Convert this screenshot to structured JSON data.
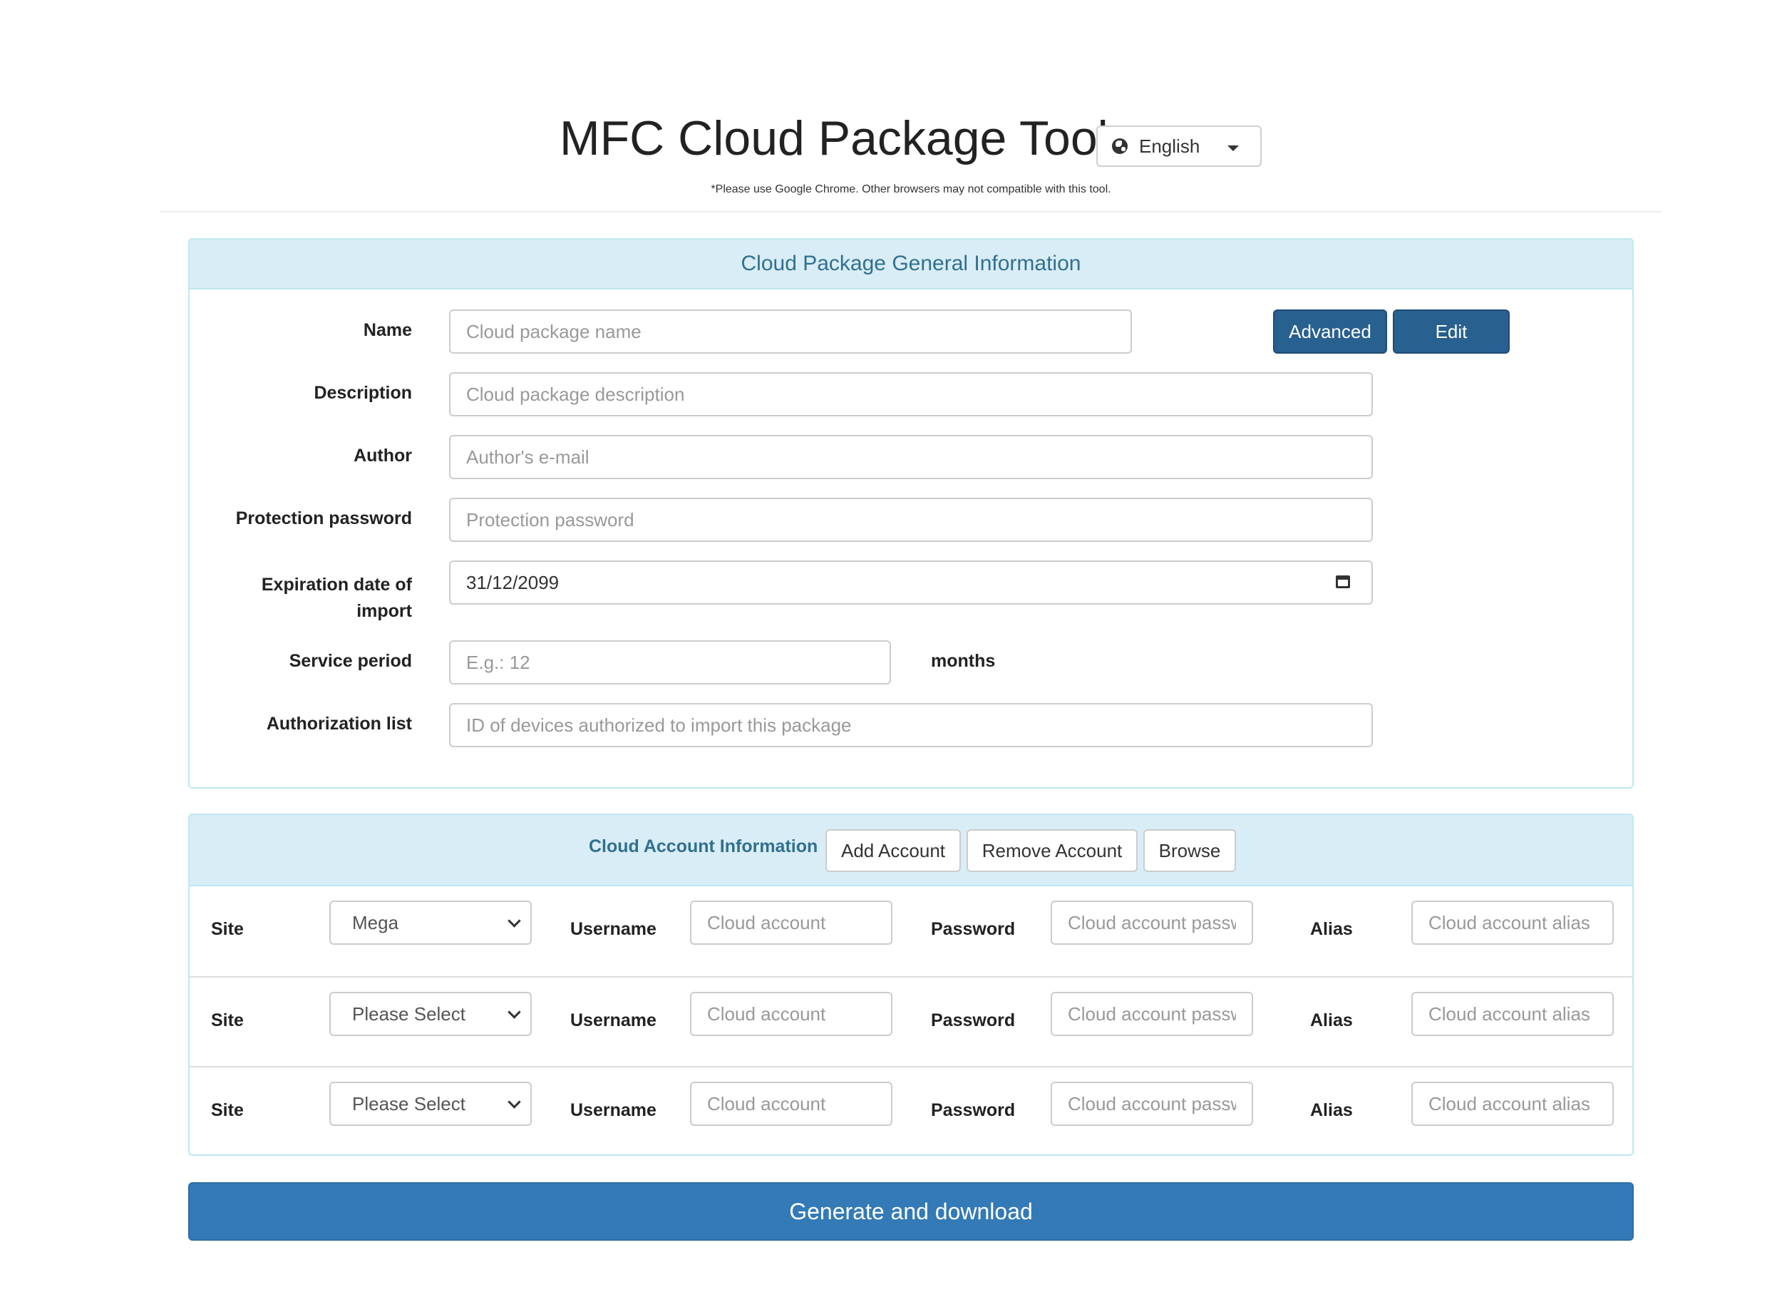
{
  "header": {
    "title": "MFC Cloud Package Tool",
    "language": "English",
    "notice": "*Please use Google Chrome. Other browsers may not compatible with this tool."
  },
  "general": {
    "heading": "Cloud Package General Information",
    "advanced_label": "Advanced",
    "edit_label": "Edit",
    "fields": {
      "name": {
        "label": "Name",
        "placeholder": "Cloud package name",
        "value": ""
      },
      "description": {
        "label": "Description",
        "placeholder": "Cloud package description",
        "value": ""
      },
      "author": {
        "label": "Author",
        "placeholder": "Author's e-mail",
        "value": ""
      },
      "protection_password": {
        "label": "Protection password",
        "placeholder": "Protection password",
        "value": ""
      },
      "expiration": {
        "label_line1": "Expiration date of",
        "label_line2": "import",
        "value": "31/12/2099"
      },
      "service_period": {
        "label": "Service period",
        "placeholder": "E.g.: 12",
        "unit": "months",
        "value": ""
      },
      "authorization_list": {
        "label": "Authorization list",
        "placeholder": "ID of devices authorized to import this package",
        "value": ""
      }
    }
  },
  "accounts": {
    "heading": "Cloud Account Information",
    "add_label": "Add Account",
    "remove_label": "Remove Account",
    "browse_label": "Browse",
    "column_labels": {
      "site": "Site",
      "username": "Username",
      "password": "Password",
      "alias": "Alias"
    },
    "placeholders": {
      "username": "Cloud account",
      "password": "Cloud account passw",
      "alias": "Cloud account alias"
    },
    "rows": [
      {
        "site": "Mega"
      },
      {
        "site": "Please Select"
      },
      {
        "site": "Please Select"
      }
    ]
  },
  "footer": {
    "generate_label": "Generate and download"
  },
  "colors": {
    "primary": "#337ab7",
    "primary_dark": "#286090",
    "panel_heading_bg": "#d9edf7",
    "panel_border": "#bce8f1",
    "panel_heading_text": "#31708f"
  }
}
